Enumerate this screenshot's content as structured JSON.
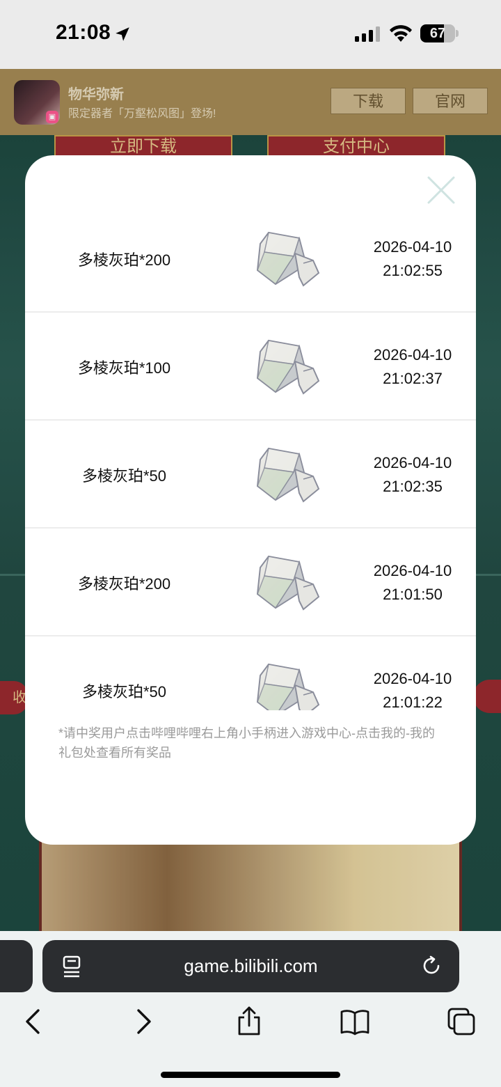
{
  "status_bar": {
    "time": "21:08",
    "battery_level": "67",
    "icons": [
      "location-arrow-icon",
      "cellular-signal-icon",
      "wifi-icon",
      "battery-icon"
    ]
  },
  "background_page": {
    "app_banner": {
      "app_name": "物华弥新",
      "app_desc": "限定器者「万壑松风图」登场!",
      "download_label": "下载",
      "official_site_label": "官网"
    },
    "buttons": [
      "立即下载",
      "支付中心"
    ],
    "side_tab_label": "收"
  },
  "modal": {
    "close_icon": "close-icon",
    "records": [
      {
        "name": "多棱灰珀*200",
        "date": "2026-04-10",
        "time": "21:02:55",
        "icon": "crystal-cube-icon"
      },
      {
        "name": "多棱灰珀*100",
        "date": "2026-04-10",
        "time": "21:02:37",
        "icon": "crystal-cube-icon"
      },
      {
        "name": "多棱灰珀*50",
        "date": "2026-04-10",
        "time": "21:02:35",
        "icon": "crystal-cube-icon"
      },
      {
        "name": "多棱灰珀*200",
        "date": "2026-04-10",
        "time": "21:01:50",
        "icon": "crystal-cube-icon"
      },
      {
        "name": "多棱灰珀*50",
        "date": "2026-04-10",
        "time": "21:01:22",
        "icon": "crystal-cube-icon"
      }
    ],
    "note": "*请中奖用户点击哔哩哔哩右上角小手柄进入游戏中心-点击我的-我的礼包处查看所有奖品"
  },
  "browser": {
    "url": "game.bilibili.com",
    "icons": [
      "reader-icon",
      "reload-icon",
      "back-icon",
      "forward-icon",
      "share-icon",
      "bookmarks-icon",
      "tabs-icon"
    ]
  },
  "colors": {
    "page_green": "#1f4a42",
    "banner_gold": "#a58a55",
    "accent_red": "#9a2a2f"
  }
}
